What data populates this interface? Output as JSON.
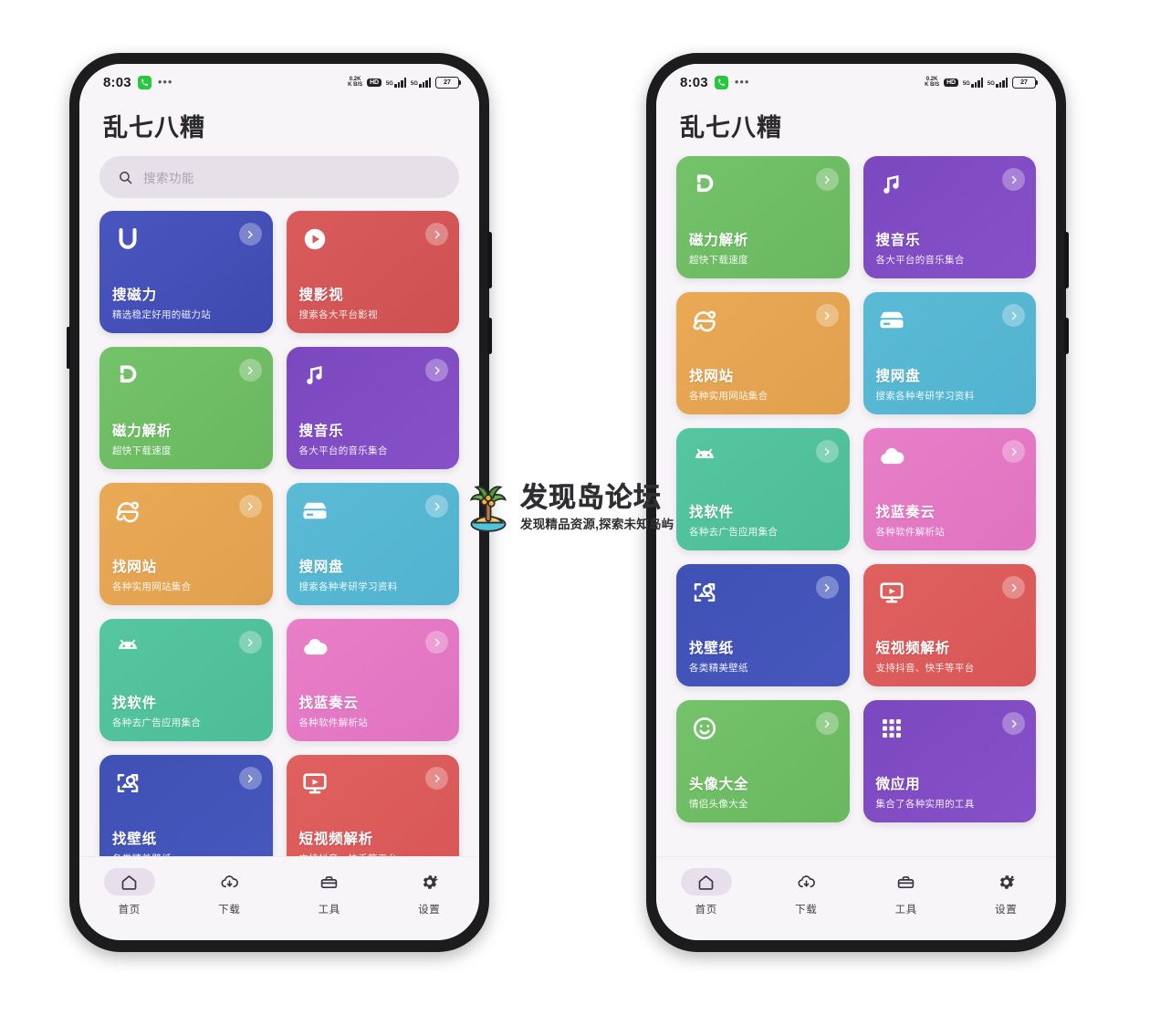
{
  "colors": {
    "screen_bg": "#f8f5f9",
    "search_bg": "#e6e1e9",
    "tab_active_pill": "#e7e0ec",
    "frame": "#1c1c1e"
  },
  "status_bar": {
    "time": "8:03",
    "phone_icon": "phone-icon",
    "overflow_dots": "•••",
    "net_speed_top": "0.2K",
    "net_speed_bottom": "K B/S",
    "hd_label": "HD",
    "signal_1_gen": "5G",
    "signal_2_gen": "5G",
    "battery_percent": "27"
  },
  "header": {
    "app_title": "乱七八糟"
  },
  "search": {
    "icon": "search-icon",
    "placeholder": "搜索功能"
  },
  "cards": [
    {
      "id": "soucili",
      "title": "搜磁力",
      "sub": "精选稳定好用的磁力站",
      "icon": "u-letter-icon",
      "color_from": "#4a56bf",
      "color_to": "#3f4ab0"
    },
    {
      "id": "souyingshi",
      "title": "搜影视",
      "sub": "搜索各大平台影视",
      "icon": "play-circle-icon",
      "color_from": "#d95b5b",
      "color_to": "#cf5050"
    },
    {
      "id": "cilijiexi",
      "title": "磁力解析",
      "sub": "超快下载速度",
      "icon": "magnet-icon",
      "color_from": "#74c26a",
      "color_to": "#69b85f"
    },
    {
      "id": "souyinyue",
      "title": "搜音乐",
      "sub": "各大平台的音乐集合",
      "icon": "music-note-icon",
      "color_from": "#7b48c0",
      "color_to": "#8750c8"
    },
    {
      "id": "zhaowangzhan",
      "title": "找网站",
      "sub": "各种实用网站集合",
      "icon": "ie-browser-icon",
      "color_from": "#e9a955",
      "color_to": "#e0a04e"
    },
    {
      "id": "souwangpan",
      "title": "搜网盘",
      "sub": "搜索各种考研学习资料",
      "icon": "hard-drive-icon",
      "color_from": "#5bbbd6",
      "color_to": "#52b3d0"
    },
    {
      "id": "zhaoruanjian",
      "title": "找软件",
      "sub": "各种去广告应用集合",
      "icon": "android-icon",
      "color_from": "#55c6a0",
      "color_to": "#4cbd97"
    },
    {
      "id": "zhaolanzouyun",
      "title": "找蓝奏云",
      "sub": "各种软件解析站",
      "icon": "cloud-icon",
      "color_from": "#e87ec8",
      "color_to": "#e073c0"
    },
    {
      "id": "zhaobizhi",
      "title": "找壁纸",
      "sub": "各类精美壁纸",
      "icon": "image-search-icon",
      "color_from": "#3f51b5",
      "color_to": "#4757bd"
    },
    {
      "id": "duanshipin",
      "title": "短视频解析",
      "sub": "支持抖音、快手等平台",
      "icon": "video-screen-icon",
      "color_from": "#e06060",
      "color_to": "#d85656"
    },
    {
      "id": "touxiang",
      "title": "头像大全",
      "sub": "情侣头像大全",
      "icon": "smiley-icon",
      "color_from": "#74c26a",
      "color_to": "#69b85f"
    },
    {
      "id": "weiyingyong",
      "title": "微应用",
      "sub": "集合了各种实用的工具",
      "icon": "grid-apps-icon",
      "color_from": "#7b48c0",
      "color_to": "#8750c8"
    }
  ],
  "card_arrow_icon": "chevron-right-icon",
  "tabbar": {
    "items": [
      {
        "label": "首页",
        "icon": "home-icon",
        "active": true
      },
      {
        "label": "下载",
        "icon": "download-cloud-icon",
        "active": false
      },
      {
        "label": "工具",
        "icon": "toolbox-icon",
        "active": false
      },
      {
        "label": "设置",
        "icon": "gear-icon",
        "active": false
      }
    ]
  },
  "phones": {
    "left": {
      "scroll_start_index": 0,
      "label": "phone-left"
    },
    "right": {
      "scroll_start_index": 2,
      "label": "phone-right"
    }
  },
  "watermark": {
    "title": "发现岛论坛",
    "subtitle": "发现精品资源,探索未知岛屿",
    "logo": "palm-island-icon"
  }
}
